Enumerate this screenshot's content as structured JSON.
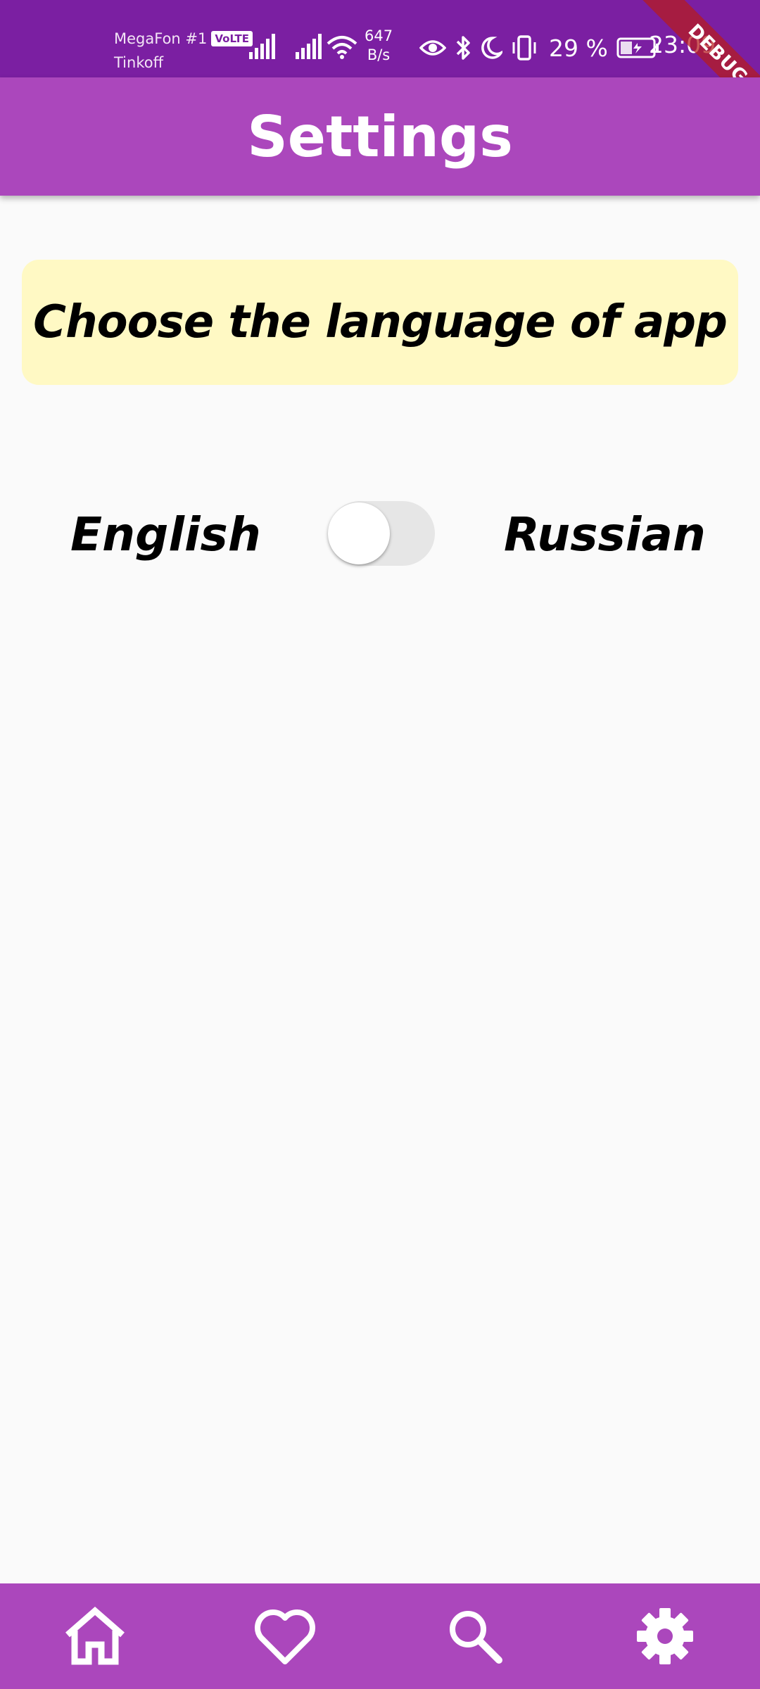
{
  "status_bar": {
    "carrier_primary": "MegaFon #1",
    "volte_badge": "VoLTE",
    "carrier_secondary": "Tinkoff",
    "net_speed_value": "647",
    "net_speed_unit": "B/s",
    "battery_percent": "29 %",
    "time": "23:09",
    "icons": [
      "signal-icon",
      "signal-icon",
      "wifi-icon",
      "eye-icon",
      "bluetooth-icon",
      "moon-icon",
      "vibrate-icon",
      "battery-charging-icon"
    ]
  },
  "debug_banner": "DEBUG",
  "app_bar": {
    "title": "Settings"
  },
  "language_card": {
    "text": "Choose the language of app"
  },
  "language_toggle": {
    "left_label": "English",
    "right_label": "Russian",
    "state": "off",
    "thumb_position": "left"
  },
  "bottom_nav": {
    "items": [
      {
        "icon": "home-icon"
      },
      {
        "icon": "heart-icon"
      },
      {
        "icon": "search-icon"
      },
      {
        "icon": "settings-icon"
      }
    ]
  },
  "colors": {
    "status_bar": "#7b1fa2",
    "app_bar": "#ab47bc",
    "card": "#fff9c4",
    "background": "#fafafa",
    "debug_banner": "#b71c1c"
  }
}
